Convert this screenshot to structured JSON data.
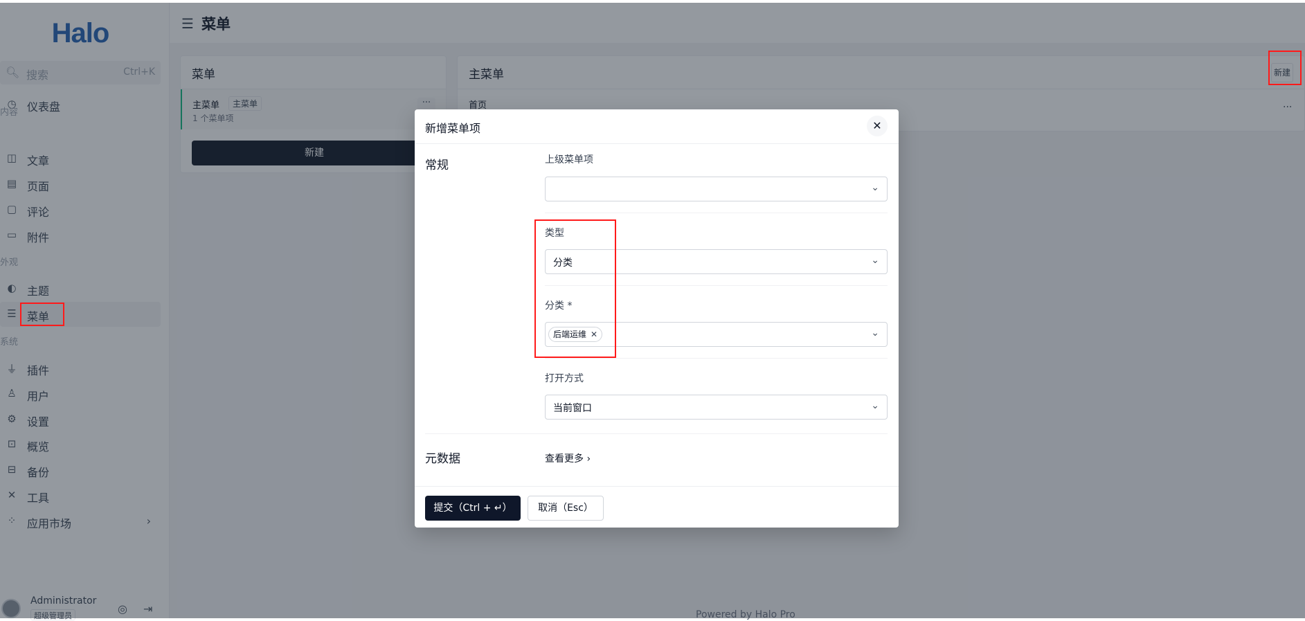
{
  "logo": "Halo",
  "search": {
    "placeholder": "搜索",
    "shortcut": "Ctrl+K",
    "icon": "search-icon"
  },
  "sidebar": {
    "dashboard": {
      "label": "仪表盘",
      "icon": "dashboard-icon"
    },
    "groups": [
      {
        "label": "内容",
        "items": [
          {
            "label": "文章",
            "icon": "post-icon"
          },
          {
            "label": "页面",
            "icon": "page-icon"
          },
          {
            "label": "评论",
            "icon": "comment-icon"
          },
          {
            "label": "附件",
            "icon": "folder-icon"
          }
        ]
      },
      {
        "label": "外观",
        "items": [
          {
            "label": "主题",
            "icon": "palette-icon"
          },
          {
            "label": "菜单",
            "icon": "menu-settings-icon",
            "active": true
          }
        ]
      },
      {
        "label": "系统",
        "items": [
          {
            "label": "插件",
            "icon": "plug-icon"
          },
          {
            "label": "用户",
            "icon": "user-settings-icon"
          },
          {
            "label": "设置",
            "icon": "gear-icon"
          },
          {
            "label": "概览",
            "icon": "terminal-icon"
          },
          {
            "label": "备份",
            "icon": "backup-icon"
          },
          {
            "label": "工具",
            "icon": "tools-icon"
          },
          {
            "label": "应用市场",
            "icon": "apps-icon"
          }
        ]
      }
    ],
    "user": {
      "name": "Administrator",
      "role": "超级管理员"
    }
  },
  "header": {
    "title": "菜单"
  },
  "menus_panel": {
    "title": "菜单",
    "items": [
      {
        "name": "主菜单",
        "tag": "主菜单",
        "count": "1 个菜单项"
      }
    ],
    "new_label": "新建"
  },
  "menu_items_panel": {
    "title": "主菜单",
    "new_label": "新建",
    "items": [
      {
        "name": "首页"
      }
    ]
  },
  "footer": "Powered by Halo Pro",
  "modal": {
    "title": "新增菜单项",
    "section_general": "常规",
    "parent": {
      "label": "上级菜单项",
      "value": ""
    },
    "type": {
      "label": "类型",
      "value": "分类"
    },
    "category": {
      "label": "分类 *",
      "tags": [
        "后端运维"
      ]
    },
    "target": {
      "label": "打开方式",
      "value": "当前窗口"
    },
    "section_meta": "元数据",
    "see_more": "查看更多",
    "submit": "提交（Ctrl + ↵）",
    "cancel": "取消（Esc）"
  },
  "colors": {
    "accent": "#0f172a",
    "logo": "#2563b5",
    "annotation": "#ff1a1a",
    "active_indicator": "#10b981"
  }
}
